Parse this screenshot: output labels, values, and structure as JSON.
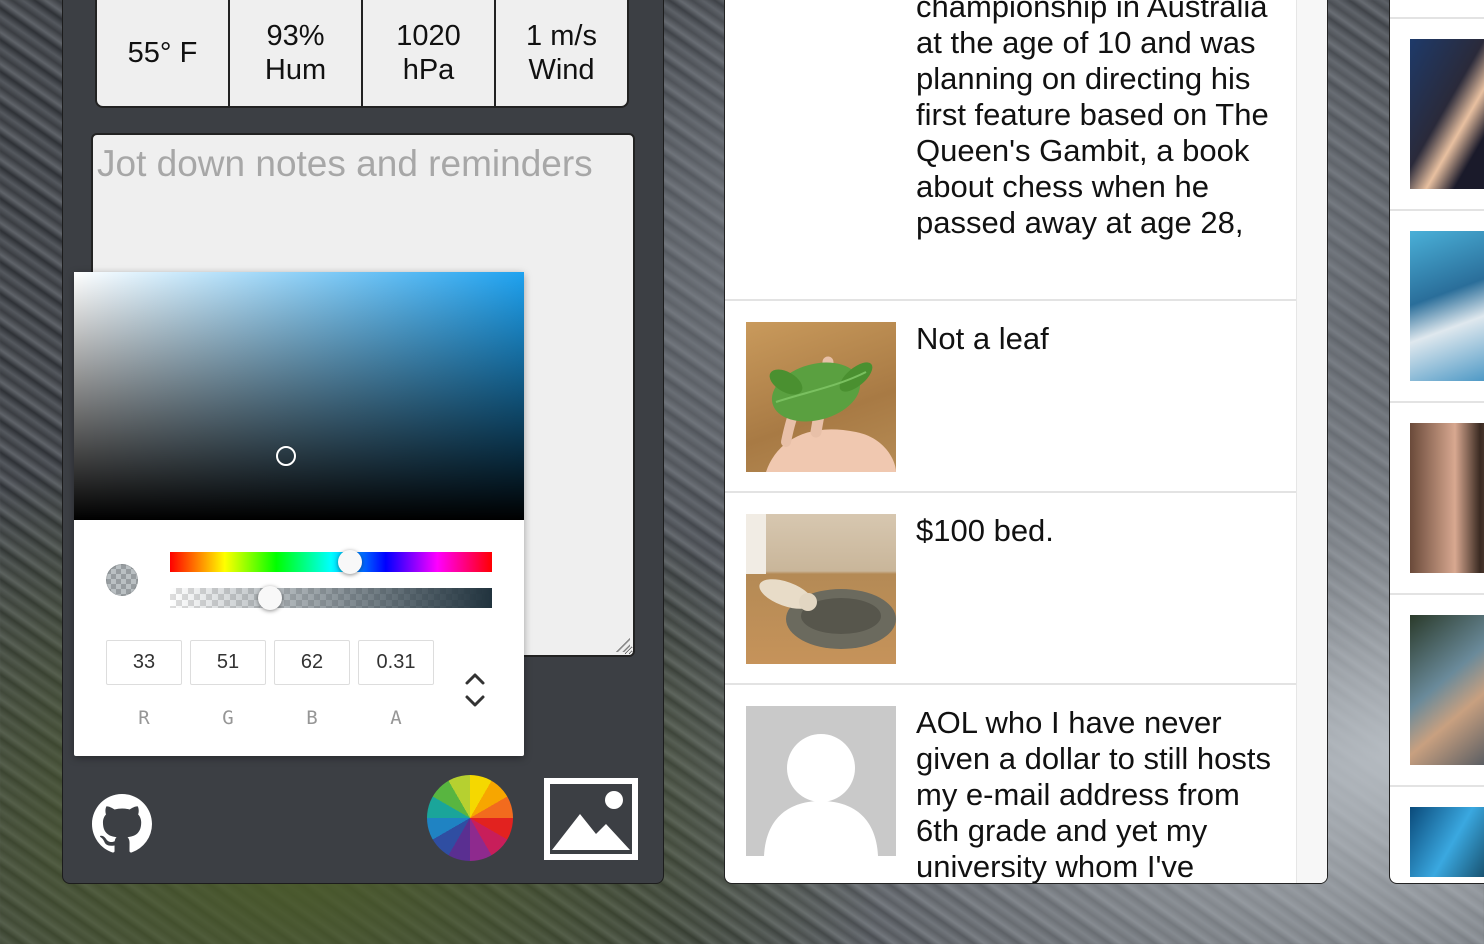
{
  "weather": {
    "temp": "55° F",
    "humidity_value": "93%",
    "humidity_label": "Hum",
    "pressure_value": "1020",
    "pressure_label": "hPa",
    "wind_value": "1 m/s",
    "wind_label": "Wind"
  },
  "notes": {
    "placeholder": "Jot down notes and reminders"
  },
  "color_picker": {
    "r": "33",
    "g": "51",
    "b": "62",
    "a": "0.31",
    "r_label": "R",
    "g_label": "G",
    "b_label": "B",
    "a_label": "A",
    "hue_position_percent": 56,
    "alpha_position_percent": 31,
    "sv_saturation": 0.47,
    "sv_value": 0.26
  },
  "bottom_icons": [
    "github-icon",
    "color-wheel-icon",
    "image-icon"
  ],
  "feed": {
    "items": [
      {
        "text": "championship in Australia at the age of 10 and was planning on directing his first feature based on The Queen's Gambit, a book about chess when he passed away at age 28,"
      },
      {
        "text": "Not a leaf"
      },
      {
        "text": "$100 bed."
      },
      {
        "text": "AOL who I have never given a dollar to still hosts my e-mail address from 6th grade and yet my university whom I've"
      }
    ]
  },
  "colors": {
    "panel_bg": "#3c3f44",
    "weather_bg": "#efefef",
    "picker_hue": "#1ea2f0"
  }
}
